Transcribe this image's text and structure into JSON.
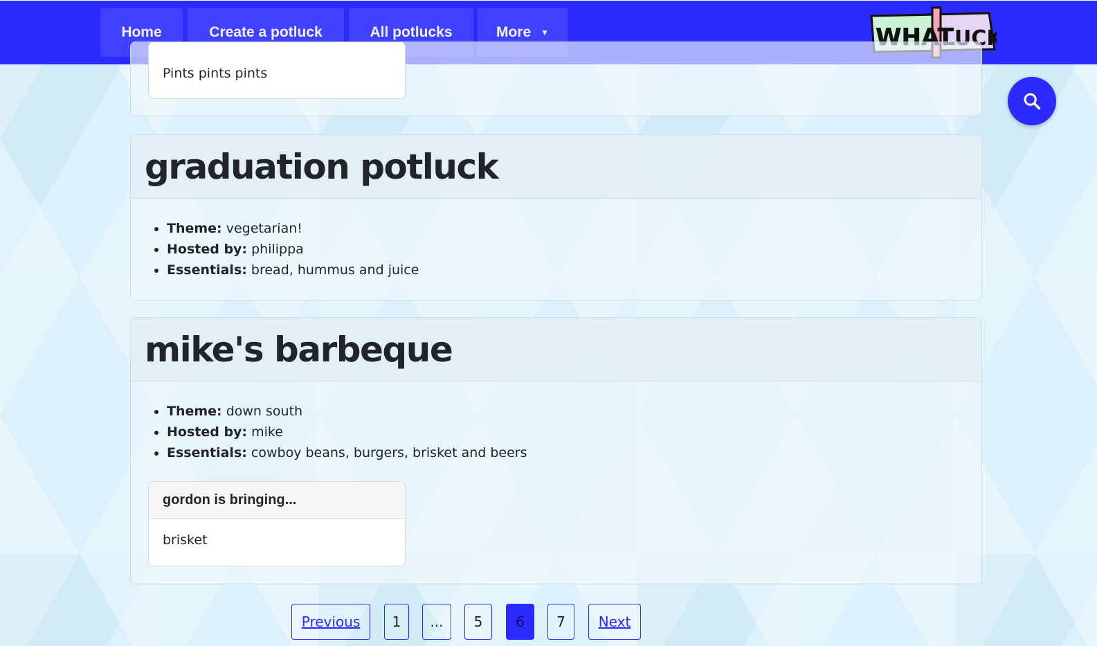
{
  "nav": {
    "home": "Home",
    "create": "Create a potluck",
    "all": "All potlucks",
    "more": "More",
    "logo_text_1": "WHAT",
    "logo_text_2": "LUCK"
  },
  "previous_potluck": {
    "bringing_item": "Pints pints pints"
  },
  "potlucks": [
    {
      "title": "graduation potluck",
      "theme_label": "Theme:",
      "theme": "vegetarian!",
      "host_label": "Hosted by:",
      "host": "philippa",
      "essentials_label": "Essentials:",
      "essentials": "bread, hummus and juice"
    },
    {
      "title": "mike's barbeque",
      "theme_label": "Theme:",
      "theme": "down south",
      "host_label": "Hosted by:",
      "host": "mike",
      "essentials_label": "Essentials:",
      "essentials": "cowboy beans, burgers, brisket and beers",
      "bringing_header": "gordon is bringing...",
      "bringing_item": "brisket"
    }
  ],
  "pagination": {
    "previous": "Previous",
    "pages": [
      "1",
      "...",
      "5",
      "6",
      "7"
    ],
    "current": "6",
    "next": "Next"
  },
  "colors": {
    "brand": "#2b2bff",
    "nav_button": "#4040ff"
  },
  "icons": {
    "search": "search-icon",
    "dropdown": "caret-down-icon"
  }
}
